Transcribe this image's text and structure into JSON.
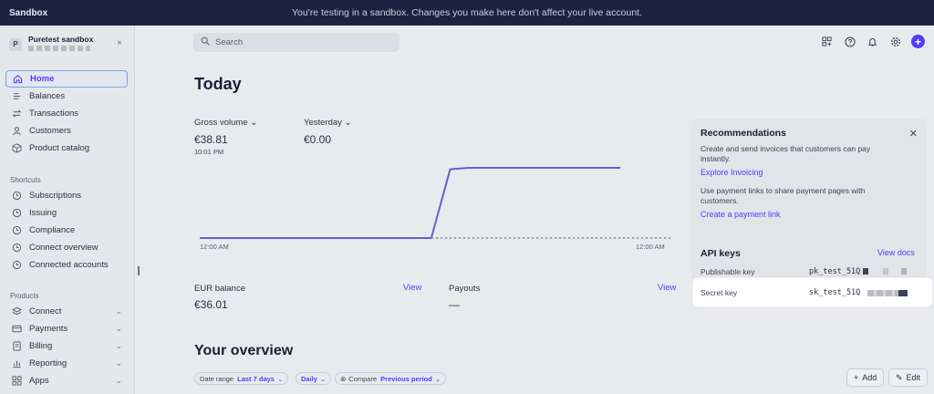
{
  "banner": {
    "brand": "Sandbox",
    "message": "You're testing in a sandbox. Changes you make here don't affect your live account."
  },
  "account": {
    "avatar_letter": "P",
    "name": "Puretest sandbox",
    "close_glyph": "×"
  },
  "nav": {
    "main": [
      {
        "label": "Home",
        "icon": "home-icon",
        "active": true
      },
      {
        "label": "Balances",
        "icon": "balances-icon"
      },
      {
        "label": "Transactions",
        "icon": "transactions-icon"
      },
      {
        "label": "Customers",
        "icon": "customers-icon"
      },
      {
        "label": "Product catalog",
        "icon": "product-catalog-icon"
      }
    ],
    "shortcuts_label": "Shortcuts",
    "shortcuts": [
      {
        "label": "Subscriptions"
      },
      {
        "label": "Issuing"
      },
      {
        "label": "Compliance"
      },
      {
        "label": "Connect overview"
      },
      {
        "label": "Connected accounts"
      }
    ],
    "products_label": "Products",
    "products": [
      {
        "label": "Connect",
        "icon": "connect-icon"
      },
      {
        "label": "Payments",
        "icon": "payments-icon"
      },
      {
        "label": "Billing",
        "icon": "billing-icon"
      },
      {
        "label": "Reporting",
        "icon": "reporting-icon"
      },
      {
        "label": "Apps",
        "icon": "apps-icon"
      }
    ]
  },
  "search": {
    "placeholder": "Search"
  },
  "today": {
    "title": "Today",
    "gross_label": "Gross volume",
    "gross_value": "€38.81",
    "gross_time": "10:01 PM",
    "yesterday_label": "Yesterday",
    "yesterday_value": "€0.00",
    "tick_start": "12:00 AM",
    "tick_end": "12:00 AM"
  },
  "chart_data": {
    "type": "line",
    "xlabel": "",
    "ylabel": "",
    "x_ticks": [
      "12:00 AM",
      "12:00 AM"
    ],
    "series": [
      {
        "name": "Gross volume",
        "color": "#6a5ad6",
        "points": [
          [
            0,
            0
          ],
          [
            0.49,
            0
          ],
          [
            0.53,
            38
          ],
          [
            0.57,
            38.81
          ],
          [
            0.89,
            38.81
          ]
        ]
      },
      {
        "name": "Yesterday",
        "color": "#8a8fa0",
        "dashed": true,
        "points": [
          [
            0.49,
            0
          ],
          [
            1.0,
            0
          ]
        ]
      }
    ]
  },
  "balances": {
    "eur_label": "EUR balance",
    "eur_value": "€36.01",
    "eur_view": "View",
    "payouts_label": "Payouts",
    "payouts_value": "—",
    "payouts_view": "View"
  },
  "overview": {
    "title": "Your overview",
    "date_range_label": "Date range",
    "date_range_value": "Last 7 days",
    "interval_value": "Daily",
    "compare_label": "Compare",
    "compare_value": "Previous period",
    "add_label": "Add",
    "edit_label": "Edit"
  },
  "recommendations": {
    "title": "Recommendations",
    "close_glyph": "✕",
    "item1_text": "Create and send invoices that customers can pay instantly.",
    "item1_link": "Explore Invoicing",
    "item2_text": "Use payment links to share payment pages with customers.",
    "item2_link": "Create a payment link"
  },
  "api_keys": {
    "title": "API keys",
    "docs_link": "View docs",
    "publishable_label": "Publishable key",
    "publishable_value": "pk_test_51Q",
    "secret_label": "Secret key",
    "secret_value": "sk_test_51Q"
  },
  "colors": {
    "accent": "#533afd",
    "banner": "#1b2340"
  }
}
